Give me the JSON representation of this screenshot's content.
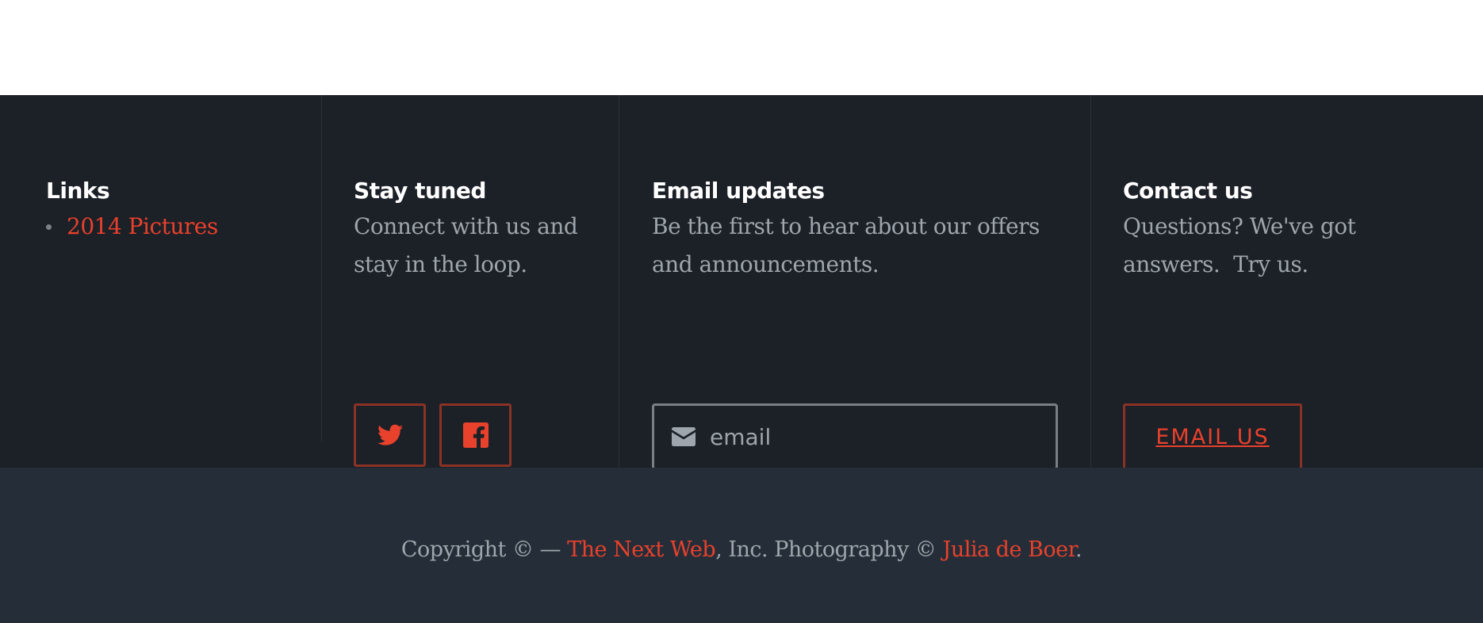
{
  "links": {
    "heading": "Links",
    "items": [
      {
        "label": "2014 Pictures"
      }
    ]
  },
  "stay_tuned": {
    "heading": "Stay tuned",
    "description_line1": "Connect with us and",
    "description_line2": "stay in the loop.",
    "icons": [
      "twitter-icon",
      "facebook-icon"
    ]
  },
  "email_updates": {
    "heading": "Email updates",
    "description_line1": "Be the first to hear about our offers",
    "description_line2": "and announcements.",
    "input_placeholder": "email",
    "icon": "envelope-icon"
  },
  "contact": {
    "heading": "Contact us",
    "description_line1": "Questions? We've got",
    "description_line2": "answers.  Try us.",
    "button_label": "EMAIL US"
  },
  "copyright": {
    "prefix": "Copyright © — ",
    "company_link": "The Next Web",
    "middle": ", Inc. Photography © ",
    "photographer_link": "Julia de Boer",
    "suffix": "."
  },
  "colors": {
    "accent": "#e8412c",
    "footer_bg": "#1c2027",
    "bottom_bg": "#252e38",
    "muted_text": "#9ea5ad"
  }
}
